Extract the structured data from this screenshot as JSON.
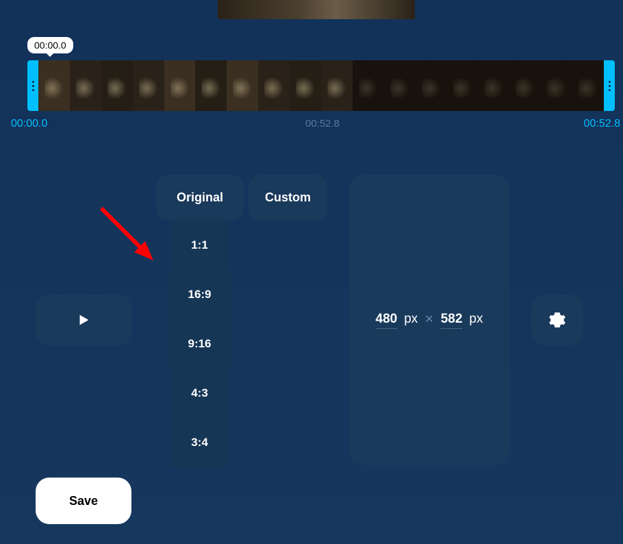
{
  "timeline": {
    "badge_time": "00:00.0",
    "start_label": "00:00.0",
    "mid_label": "00:52.8",
    "end_label": "00:52.8"
  },
  "tabs": {
    "original": "Original",
    "custom": "Custom"
  },
  "ratios": {
    "r11": "1:1",
    "r169": "16:9",
    "r916": "9:16",
    "r43": "4:3",
    "r34": "3:4"
  },
  "dimensions": {
    "width": "480",
    "width_unit": "px",
    "separator": "✕",
    "height": "582",
    "height_unit": "px"
  },
  "buttons": {
    "save": "Save"
  }
}
